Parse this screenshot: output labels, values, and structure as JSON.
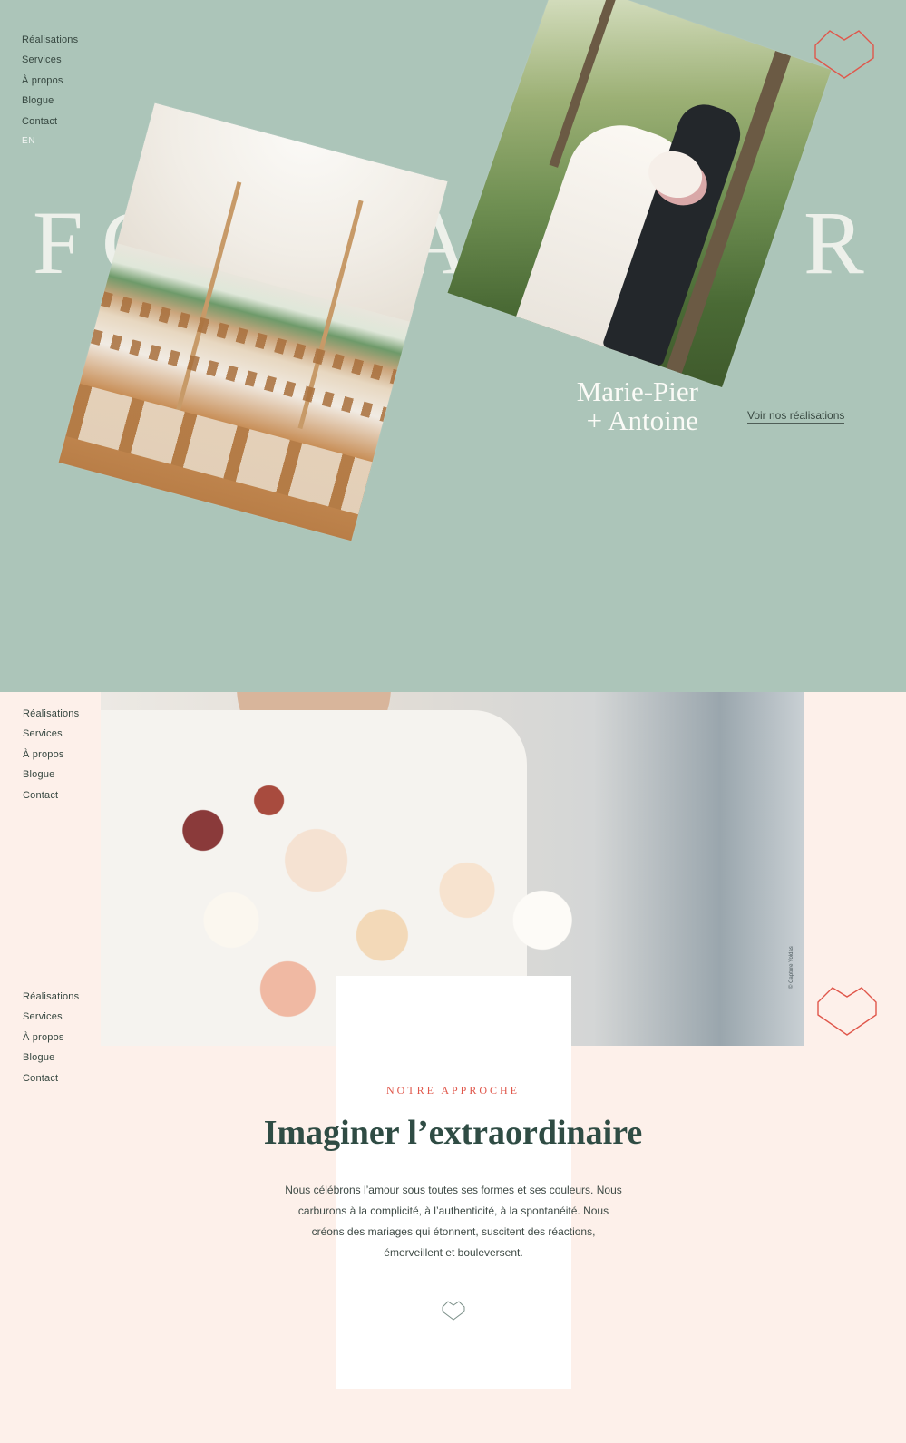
{
  "hero": {
    "nav": [
      "Réalisations",
      "Services",
      "À propos",
      "Blogue",
      "Contact"
    ],
    "language": "EN",
    "big_word_parts": [
      "F",
      "C",
      "A",
      "R"
    ],
    "couple_name_line1": "Marie-Pier",
    "couple_name_line2": "+ Antoine",
    "cta": "Voir nos réalisations"
  },
  "second_section": {
    "nav_primary": [
      "Réalisations",
      "Services",
      "À propos",
      "Blogue",
      "Contact"
    ],
    "nav_secondary": [
      "Réalisations",
      "Services",
      "À propos",
      "Blogue",
      "Contact"
    ],
    "photo_credit": "© Capture Yoldas"
  },
  "approach": {
    "eyebrow": "NOTRE APPROCHE",
    "headline": "Imaginer l’extraordinaire",
    "body": "Nous célébrons l’amour sous toutes ses formes et ses couleurs. Nous carburons à la complicité, à l’authenticité, à la spontanéité. Nous créons des mariages qui étonnent, suscitent des réactions, émerveillent et bouleversent."
  },
  "colors": {
    "hero_bg": "#acc5b9",
    "section_bg": "#fdf0ea",
    "accent_coral": "#e0574b",
    "heading_green": "#2f4c44"
  },
  "icons": {
    "logo": "heart-outline-icon",
    "divider": "heart-outline-icon"
  }
}
